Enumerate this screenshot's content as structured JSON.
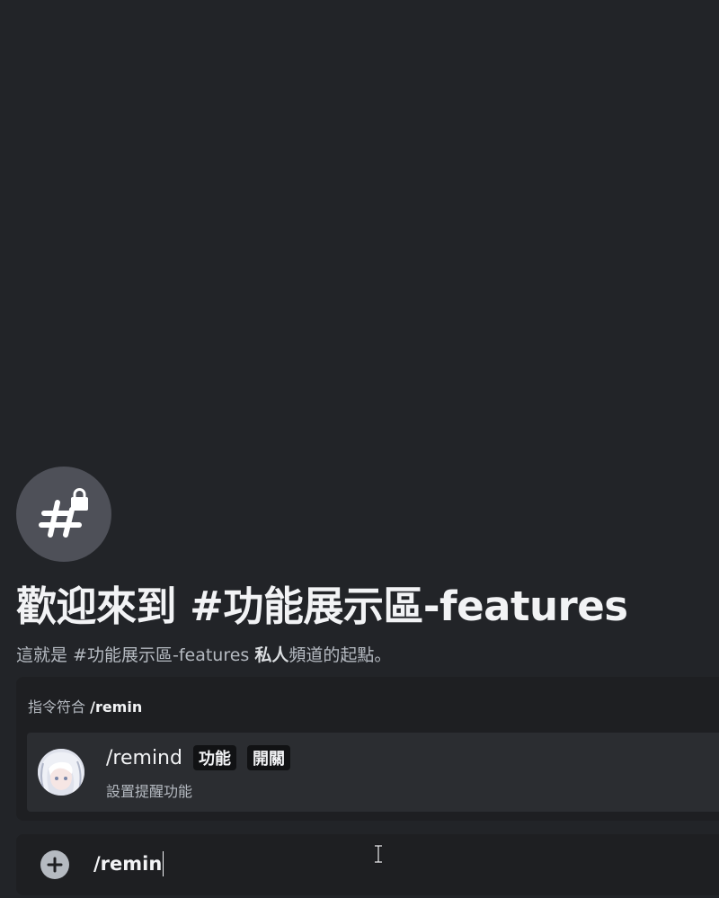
{
  "welcome": {
    "title": "歡迎來到 #功能展示區-features",
    "subtitle_prefix": "這就是 #功能展示區-features ",
    "subtitle_bold": "私人",
    "subtitle_suffix": "頻道的起點。"
  },
  "autocomplete": {
    "header_label": "指令符合 ",
    "query": "/remin",
    "items": [
      {
        "command": "/remind",
        "tags": [
          "功能",
          "開關"
        ],
        "description": "設置提醒功能"
      }
    ]
  },
  "composer": {
    "value": "/remin"
  },
  "icons": {
    "channel": "hash-lock-icon",
    "add": "plus-circle-icon",
    "cursor": "text-cursor-icon"
  },
  "colors": {
    "background": "#222428",
    "panel": "#1e1f22",
    "item_selected": "#2b2d31",
    "channel_icon_bg": "#4e5058"
  }
}
